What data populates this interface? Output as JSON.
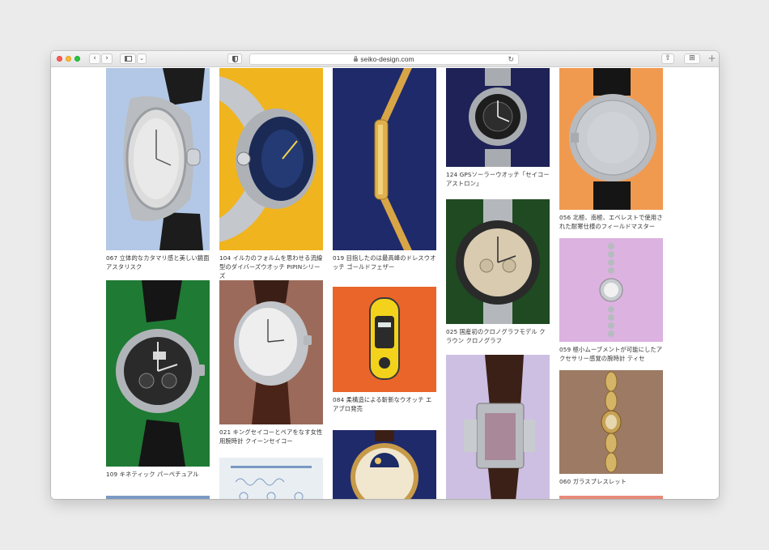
{
  "browser": {
    "url": "seiko-design.com",
    "nav_back": "‹",
    "nav_forward": "›",
    "sidebar_dropdown": "⌄",
    "reload": "↻",
    "share": "⇧",
    "tab_overview": "⊞",
    "new_tab": "+"
  },
  "gallery": {
    "items": [
      {
        "caption": "067 立体的なカタマリ感と美しい鏡面 アスタリスク",
        "bg": "#b3c8e6"
      },
      {
        "caption": "104 イルカのフォルムを思わせる流線型のダイバーズウオッチ PIPINシリーズ",
        "bg": "#f0b41e"
      },
      {
        "caption": "019 目指したのは最高峰のドレスウオッチ ゴールドフェザー",
        "bg": "#1f2a6b"
      },
      {
        "caption": "124 GPSソーラーウオッチ「セイコー アストロン」",
        "bg": "#1e2256"
      },
      {
        "caption": "056 北極、南極、エベレストで使用された耐寒仕様のフィールドマスター",
        "bg": "#f09a50"
      },
      {
        "caption": "109 キネティック パーペチュアル",
        "bg": "#1f7a34"
      },
      {
        "caption": "021 キングセイコーとペアをなす女性用腕時計 クイーンセイコー",
        "bg": "#9c6a5a"
      },
      {
        "caption": "084 柔構造による斬新なウオッチ エアブロ発売",
        "bg": "#e9652a"
      },
      {
        "caption": "025 国産初のクロノグラフモデル クラウン クロノグラフ",
        "bg": "#1f4a22"
      },
      {
        "caption": "059 極小ムーブメントが可能にしたアクセサリー感覚の腕時計 ティセ",
        "bg": "#dcb2e0"
      },
      {
        "caption": "060 ガラスブレスレット",
        "bg": "#9c7a64"
      },
      {
        "caption": "",
        "bg": "#cdbfe2"
      },
      {
        "caption": "",
        "bg": "#1f2a6b"
      },
      {
        "caption": "",
        "bg": "#e9eef2"
      },
      {
        "caption": "",
        "bg": "#7a9ac4"
      },
      {
        "caption": "",
        "bg": "#e88a7a"
      }
    ]
  }
}
